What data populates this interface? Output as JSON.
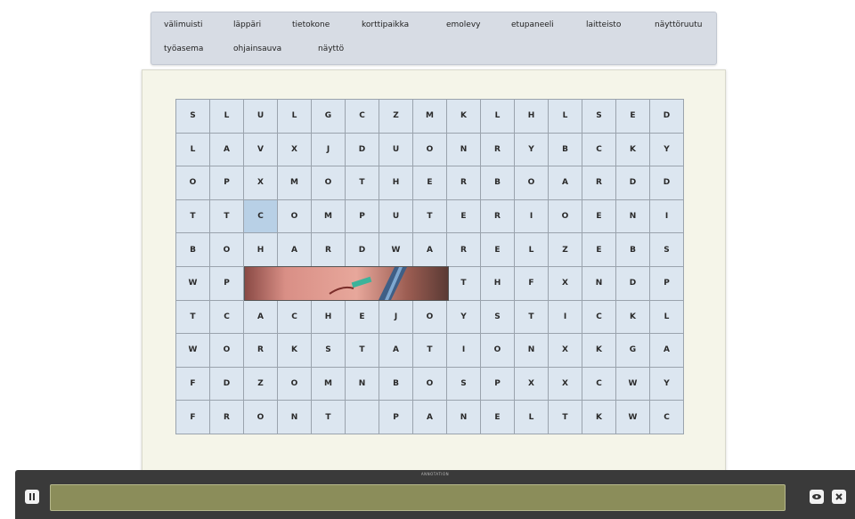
{
  "wordbank": {
    "words": [
      "välimuisti",
      "läppäri",
      "tietokone",
      "korttipaikka",
      "emolevy",
      "etupaneeli",
      "laitteisto",
      "näyttöruutu",
      "työasema",
      "ohjainsauva",
      "näyttö"
    ]
  },
  "grid": {
    "rows": [
      [
        "S",
        "L",
        "U",
        "L",
        "G",
        "C",
        "Z",
        "M",
        "K",
        "L",
        "H",
        "L",
        "S",
        "E",
        "D"
      ],
      [
        "L",
        "A",
        "V",
        "X",
        "J",
        "D",
        "U",
        "O",
        "N",
        "R",
        "Y",
        "B",
        "C",
        "K",
        "Y"
      ],
      [
        "O",
        "P",
        "X",
        "M",
        "O",
        "T",
        "H",
        "E",
        "R",
        "B",
        "O",
        "A",
        "R",
        "D",
        "D"
      ],
      [
        "T",
        "T",
        "C",
        "O",
        "M",
        "P",
        "U",
        "T",
        "E",
        "R",
        "I",
        "O",
        "E",
        "N",
        "I"
      ],
      [
        "B",
        "O",
        "H",
        "A",
        "R",
        "D",
        "W",
        "A",
        "R",
        "E",
        "L",
        "Z",
        "E",
        "B",
        "S"
      ],
      [
        "W",
        "P",
        "",
        "",
        "",
        "",
        "",
        "",
        "T",
        "H",
        "F",
        "X",
        "N",
        "D",
        "P"
      ],
      [
        "T",
        "C",
        "A",
        "C",
        "H",
        "E",
        "J",
        "O",
        "Y",
        "S",
        "T",
        "I",
        "C",
        "K",
        "L"
      ],
      [
        "W",
        "O",
        "R",
        "K",
        "S",
        "T",
        "A",
        "T",
        "I",
        "O",
        "N",
        "X",
        "K",
        "G",
        "A"
      ],
      [
        "F",
        "D",
        "Z",
        "O",
        "M",
        "N",
        "B",
        "O",
        "S",
        "P",
        "X",
        "X",
        "C",
        "W",
        "Y"
      ],
      [
        "F",
        "R",
        "O",
        "N",
        "T",
        "",
        "P",
        "A",
        "N",
        "E",
        "L",
        "T",
        "K",
        "W",
        "C"
      ]
    ],
    "selected_cell": "3,2",
    "cell_color": "#dce6f0",
    "selected_color": "#b8d0e6"
  },
  "bottom_bar": {
    "title": "ANNOTATION",
    "pause_icon": "pause-icon",
    "eye_icon": "eye-icon",
    "close_icon": "close-icon",
    "progress_color": "#8b8d5a"
  }
}
